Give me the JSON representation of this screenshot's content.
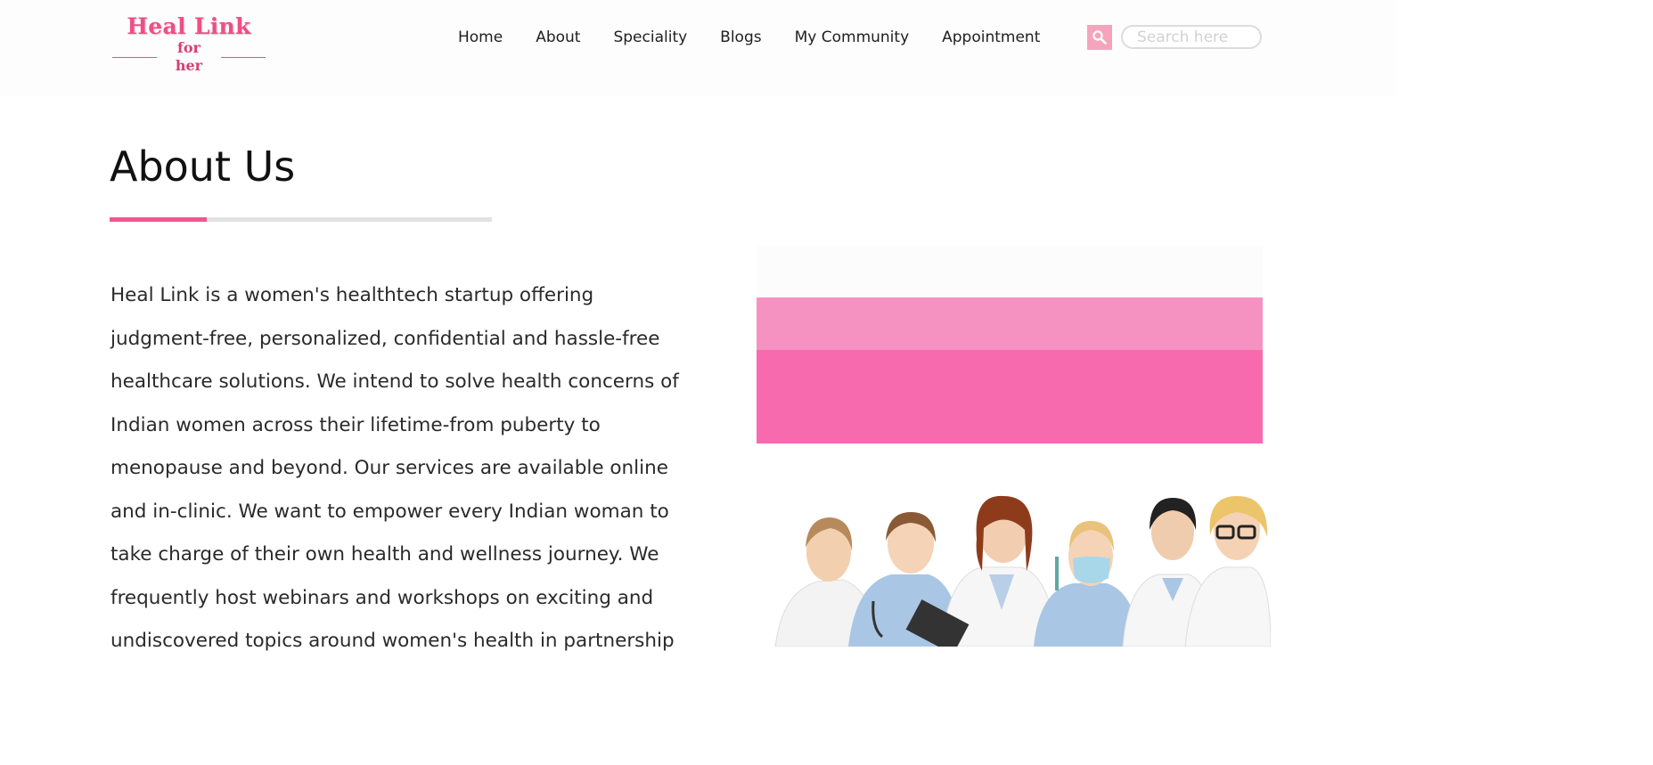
{
  "header": {
    "logo": {
      "title": "Heal Link",
      "subtitle": "for her"
    },
    "nav": [
      "Home",
      "About",
      "Speciality",
      "Blogs",
      "My Community",
      "Appointment"
    ],
    "search": {
      "placeholder": "Search here",
      "value": "",
      "icon": "search-icon"
    }
  },
  "main": {
    "title": "About Us",
    "body": "Heal Link is a women's healthtech startup offering judgment-free, personalized, confidential and hassle-free healthcare solutions. We intend to solve health concerns of Indian women across their lifetime-from puberty to menopause and beyond. Our services are available online and in-clinic. We want to empower every Indian woman to take charge of their own health and wellness journey. We frequently host webinars and workshops on exciting and undiscovered topics around women's health in partnership"
  },
  "colors": {
    "brand": "#ee4f86",
    "accent_bar": "#ee5890",
    "search_button": "#f4a4bd",
    "banner_light": "#f592c2",
    "banner_dark": "#f86aae"
  }
}
